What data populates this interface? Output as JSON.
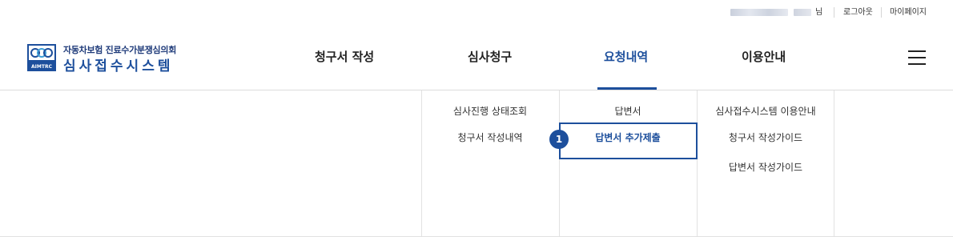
{
  "topbar": {
    "user_suffix": "님",
    "logout": "로그아웃",
    "mypage": "마이페이지"
  },
  "logo": {
    "sub": "자동차보험 진료수가분쟁심의회",
    "main": "심사접수시스템",
    "emblem_text": "AIMTRC",
    "brand_color": "#1d4f9c"
  },
  "gnb": {
    "items": [
      {
        "label": "청구서 작성"
      },
      {
        "label": "심사청구"
      },
      {
        "label": "요청내역",
        "active": true
      },
      {
        "label": "이용안내"
      }
    ],
    "menu_icon": "hamburger-icon"
  },
  "mega_menu": {
    "columns": [
      {
        "items": [
          "심사진행 상태조회",
          "청구서 작성내역"
        ]
      },
      {
        "items": [
          "답변서",
          "답변서 추가제출"
        ]
      },
      {
        "items": [
          "심사접수시스템 이용안내",
          "청구서 작성가이드",
          "답변서 작성가이드"
        ]
      }
    ],
    "highlight_badge": "1"
  }
}
